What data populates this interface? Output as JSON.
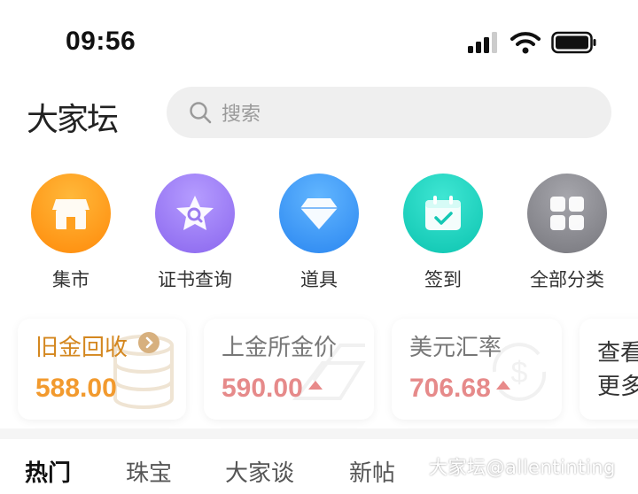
{
  "status_bar": {
    "time": "09:56"
  },
  "header": {
    "logo": "大家坛",
    "search_placeholder": "搜索"
  },
  "categories": [
    {
      "label": "集市",
      "icon": "shop-icon",
      "color": "#ff9a1a"
    },
    {
      "label": "证书查询",
      "icon": "certificate-search-icon",
      "color": "#9a7af0"
    },
    {
      "label": "道具",
      "icon": "diamond-icon",
      "color": "#3b97f5"
    },
    {
      "label": "签到",
      "icon": "calendar-check-icon",
      "color": "#18d3c0"
    },
    {
      "label": "全部分类",
      "icon": "grid-icon",
      "color": "#8a8a90"
    }
  ],
  "price_cards": [
    {
      "title": "旧金回收",
      "value": "588.00",
      "color": "#f29a2e",
      "title_color": "#d4871f",
      "has_arrow": true,
      "trend": ""
    },
    {
      "title": "上金所金价",
      "value": "590.00",
      "color": "#e68a8a",
      "title_color": "#777777",
      "has_arrow": false,
      "trend": "up"
    },
    {
      "title": "美元汇率",
      "value": "706.68",
      "color": "#e68a8a",
      "title_color": "#777777",
      "has_arrow": false,
      "trend": "up"
    }
  ],
  "more_card": {
    "line1": "查看",
    "line2": "更多"
  },
  "tabs": [
    {
      "label": "热门",
      "active": true
    },
    {
      "label": "珠宝",
      "active": false
    },
    {
      "label": "大家谈",
      "active": false
    },
    {
      "label": "新帖",
      "active": false
    },
    {
      "label": "",
      "active": false
    }
  ],
  "watermark": "大家坛@allentinting"
}
